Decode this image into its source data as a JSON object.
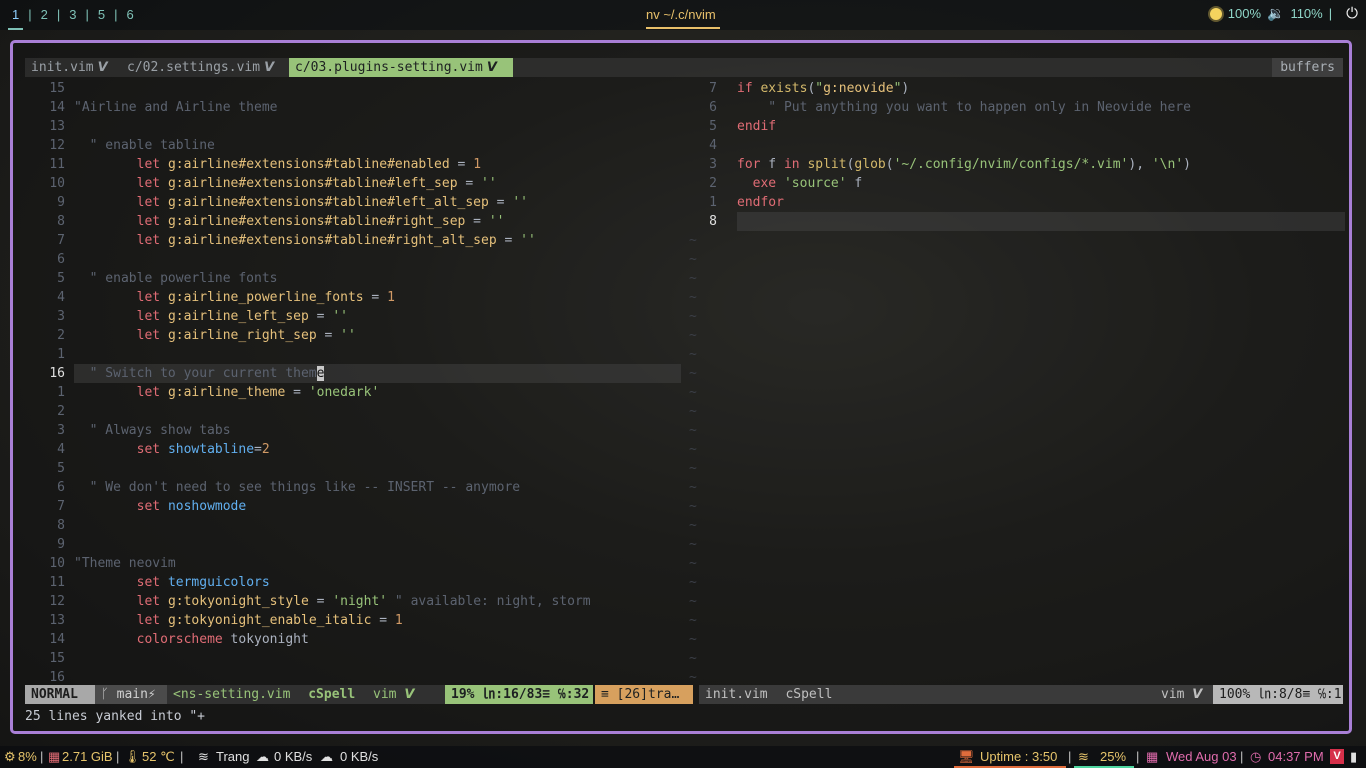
{
  "topbar": {
    "workspaces": [
      "1",
      "2",
      "3",
      "5",
      "6"
    ],
    "active_workspace": "1",
    "window_title": "nv ~/.c/nvim",
    "brightness": "100%",
    "volume": "110%",
    "separator": "|"
  },
  "tabline": {
    "tabs": [
      {
        "label": "init.vim",
        "modified": "𝙑"
      },
      {
        "label": "c/02.settings.vim",
        "modified": "𝙑"
      },
      {
        "label": "c/03.plugins-setting.vim",
        "modified": "𝙑"
      }
    ],
    "buffers_label": "buffers"
  },
  "left_pane": {
    "lines": [
      {
        "n": "15",
        "code": ""
      },
      {
        "n": "14",
        "code": "\"Airline and Airline theme"
      },
      {
        "n": "13",
        "code": ""
      },
      {
        "n": "12",
        "code": "  \" enable tabline"
      },
      {
        "n": "11",
        "code": "        let g:airline#extensions#tabline#enabled = 1"
      },
      {
        "n": "10",
        "code": "        let g:airline#extensions#tabline#left_sep = ''"
      },
      {
        "n": "9",
        "code": "        let g:airline#extensions#tabline#left_alt_sep = ''"
      },
      {
        "n": "8",
        "code": "        let g:airline#extensions#tabline#right_sep = ''"
      },
      {
        "n": "7",
        "code": "        let g:airline#extensions#tabline#right_alt_sep = ''"
      },
      {
        "n": "6",
        "code": ""
      },
      {
        "n": "5",
        "code": "  \" enable powerline fonts"
      },
      {
        "n": "4",
        "code": "        let g:airline_powerline_fonts = 1"
      },
      {
        "n": "3",
        "code": "        let g:airline_left_sep = ''"
      },
      {
        "n": "2",
        "code": "        let g:airline_right_sep = ''"
      },
      {
        "n": "1",
        "code": ""
      },
      {
        "n": "16",
        "code": "  \" Switch to your current theme"
      },
      {
        "n": "1",
        "code": "        let g:airline_theme = 'onedark'"
      },
      {
        "n": "2",
        "code": ""
      },
      {
        "n": "3",
        "code": "  \" Always show tabs"
      },
      {
        "n": "4",
        "code": "        set showtabline=2"
      },
      {
        "n": "5",
        "code": ""
      },
      {
        "n": "6",
        "code": "  \" We don't need to see things like -- INSERT -- anymore"
      },
      {
        "n": "7",
        "code": "        set noshowmode"
      },
      {
        "n": "8",
        "code": ""
      },
      {
        "n": "9",
        "code": ""
      },
      {
        "n": "10",
        "code": "\"Theme neovim"
      },
      {
        "n": "11",
        "code": "        set termguicolors"
      },
      {
        "n": "12",
        "code": "        let g:tokyonight_style = 'night' \" available: night, storm"
      },
      {
        "n": "13",
        "code": "        let g:tokyonight_enable_italic = 1"
      },
      {
        "n": "14",
        "code": "        colorscheme tokyonight"
      },
      {
        "n": "15",
        "code": ""
      },
      {
        "n": "16",
        "code": ""
      }
    ]
  },
  "right_pane": {
    "lines": [
      {
        "n": "7",
        "code": "if exists(\"g:neovide\")"
      },
      {
        "n": "6",
        "code": "    \" Put anything you want to happen only in Neovide here"
      },
      {
        "n": "5",
        "code": "endif"
      },
      {
        "n": "4",
        "code": ""
      },
      {
        "n": "3",
        "code": "for f in split(glob('~/.config/nvim/configs/*.vim'), '\\n')"
      },
      {
        "n": "2",
        "code": "  exe 'source' f"
      },
      {
        "n": "1",
        "code": "endfor"
      },
      {
        "n": "8",
        "code": ""
      }
    ],
    "tilde": "~"
  },
  "statusline_left": {
    "mode": "NORMAL",
    "branch": "ᚴ main⚡",
    "file": "<ns-setting.vim",
    "spell": "cSpell",
    "filetype": "vim 𝙑",
    "position": "19% ㏑:16/83≡ ℅:32",
    "trailing": "≡ [26]tra…"
  },
  "statusline_right": {
    "file": "init.vim",
    "spell": "cSpell",
    "filetype": "vim 𝙑",
    "position": "100% ㏑:8/8≡ ℅:1"
  },
  "cmdline": "25 lines yanked into \"+",
  "bottombar": {
    "cpu": "8%",
    "memory": "2.71 GiB",
    "temperature": "52 ℃",
    "wifi_name": "Trang",
    "download": "0 KB/s",
    "upload": "0 KB/s",
    "uptime": "Uptime : 3:50",
    "battery": "25%",
    "date": "Wed Aug 03",
    "time": "04:37 PM"
  },
  "colors": {
    "frame_border": "#a97fd6",
    "tab_active_bg": "#98c379",
    "mode_bg": "#a8a8a8"
  }
}
